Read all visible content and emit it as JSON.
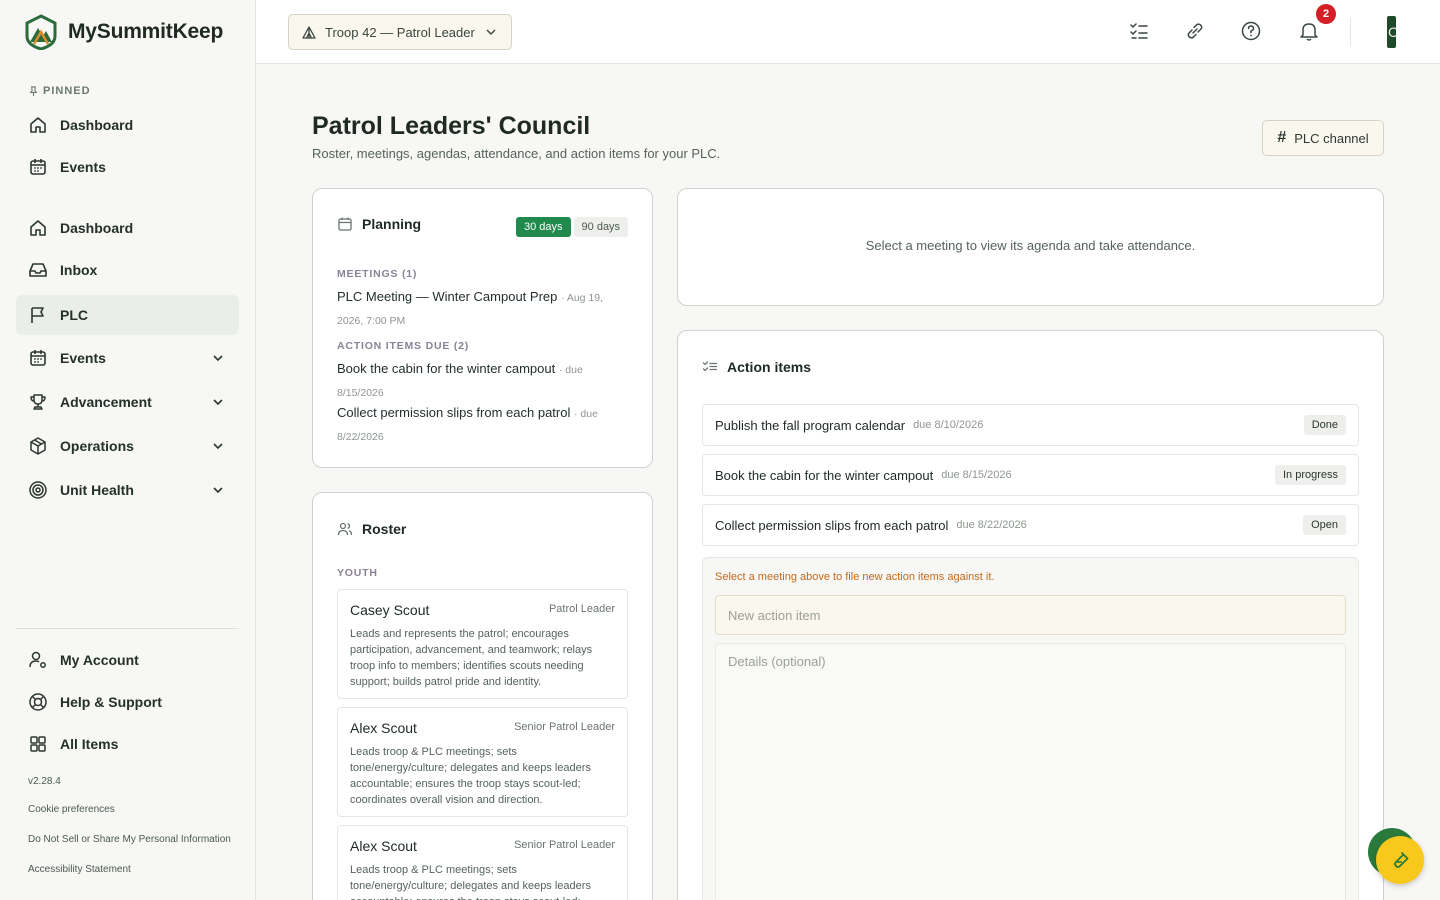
{
  "brand": {
    "name": "MySummitKeep"
  },
  "sidebar": {
    "pinned_label": "PINNED",
    "pinned": [
      {
        "label": "Dashboard",
        "icon": "home-icon"
      },
      {
        "label": "Events",
        "icon": "calendar-icon"
      }
    ],
    "items": [
      {
        "label": "Dashboard",
        "icon": "home-icon"
      },
      {
        "label": "Inbox",
        "icon": "inbox-icon"
      },
      {
        "label": "PLC",
        "icon": "flag-icon",
        "active": true
      },
      {
        "label": "Events",
        "icon": "calendar-icon",
        "expandable": true
      },
      {
        "label": "Advancement",
        "icon": "trophy-icon",
        "expandable": true
      },
      {
        "label": "Operations",
        "icon": "box-icon",
        "expandable": true
      },
      {
        "label": "Unit Health",
        "icon": "target-icon",
        "expandable": true
      }
    ],
    "footer_items": [
      {
        "label": "My Account",
        "icon": "user-settings-icon"
      },
      {
        "label": "Help & Support",
        "icon": "lifebuoy-icon"
      },
      {
        "label": "All Items",
        "icon": "grid-icon"
      }
    ],
    "version": "v2.28.4",
    "links": {
      "cookie": "Cookie preferences",
      "donotsell": "Do Not Sell or Share My Personal Information",
      "accessibility": "Accessibility Statement"
    }
  },
  "topbar": {
    "troop_select": "Troop 42 — Patrol Leader",
    "notification_count": "2",
    "avatar_initial": "C"
  },
  "page": {
    "title": "Patrol Leaders' Council",
    "subtitle": "Roster, meetings, agendas, attendance, and action items for your PLC.",
    "plc_channel_label": "PLC channel"
  },
  "planning": {
    "title": "Planning",
    "range_30": "30 days",
    "range_90": "90 days",
    "meetings_label": "MEETINGS (1)",
    "meeting": {
      "title": "PLC Meeting — Winter Campout Prep",
      "meta": "· Aug 19, 2026, 7:00 PM"
    },
    "actions_label": "ACTION ITEMS DUE (2)",
    "due_items": [
      {
        "title": "Book the cabin for the winter campout",
        "meta": "· due 8/15/2026"
      },
      {
        "title": "Collect permission slips from each patrol",
        "meta": "· due 8/22/2026"
      }
    ]
  },
  "roster": {
    "title": "Roster",
    "section": "YOUTH",
    "members": [
      {
        "name": "Casey Scout",
        "role": "Patrol Leader",
        "desc": "Leads and represents the patrol; encourages participation, advancement, and teamwork; relays troop info to members; identifies scouts needing support; builds patrol pride and identity."
      },
      {
        "name": "Alex Scout",
        "role": "Senior Patrol Leader",
        "desc": "Leads troop & PLC meetings; sets tone/energy/culture; delegates and keeps leaders accountable; ensures the troop stays scout-led; coordinates overall vision and direction."
      },
      {
        "name": "Alex Scout",
        "role": "Senior Patrol Leader",
        "desc": "Leads troop & PLC meetings; sets tone/energy/culture; delegates and keeps leaders accountable; ensures the troop stays scout-led; coordinates overall vision and direction."
      }
    ]
  },
  "meeting_panel": {
    "empty": "Select a meeting to view its agenda and take attendance."
  },
  "actions": {
    "title": "Action items",
    "items": [
      {
        "title": "Publish the fall program calendar",
        "due": "due 8/10/2026",
        "status": "Done"
      },
      {
        "title": "Book the cabin for the winter campout",
        "due": "due 8/15/2026",
        "status": "In progress"
      },
      {
        "title": "Collect permission slips from each patrol",
        "due": "due 8/22/2026",
        "status": "Open"
      }
    ],
    "warning": "Select a meeting above to file new action items against it.",
    "new_placeholder": "New action item",
    "details_placeholder": "Details (optional)"
  },
  "colors": {
    "accent": "#1f8a4c",
    "warning": "#c46a1c",
    "badge": "#d31f26",
    "fab": "#f8c81c"
  }
}
